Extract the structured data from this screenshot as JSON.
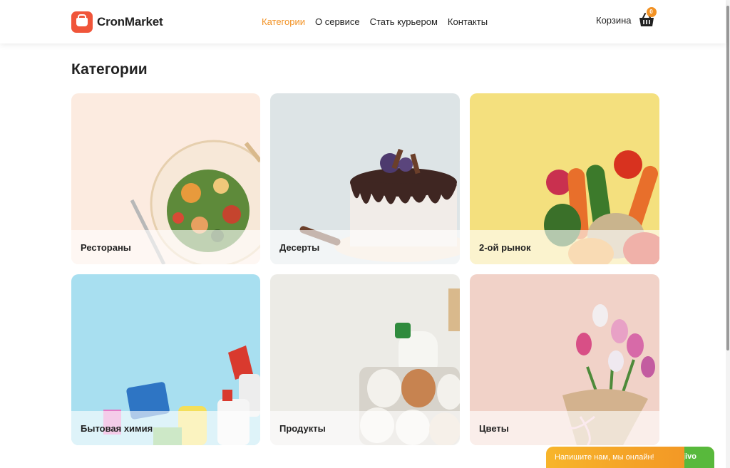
{
  "brand": {
    "name": "CronMarket",
    "accent": "#f29224",
    "logo_color": "#f0553a"
  },
  "nav": {
    "items": [
      {
        "label": "Категории",
        "active": true
      },
      {
        "label": "О сервисе",
        "active": false
      },
      {
        "label": "Стать курьером",
        "active": false
      },
      {
        "label": "Контакты",
        "active": false
      }
    ]
  },
  "cart": {
    "label": "Корзина",
    "count": "0",
    "icon": "basket-icon"
  },
  "page": {
    "title": "Категории"
  },
  "categories": [
    {
      "label": "Рестораны",
      "image": "salad-plate"
    },
    {
      "label": "Десерты",
      "image": "chocolate-cake"
    },
    {
      "label": "2-ой рынок",
      "image": "vegetables"
    },
    {
      "label": "Бытовая химия",
      "image": "cleaning-supplies"
    },
    {
      "label": "Продукты",
      "image": "eggs-and-milk"
    },
    {
      "label": "Цветы",
      "image": "tulip-bouquet"
    }
  ],
  "chat": {
    "text": "Напишите нам, мы онлайн!",
    "logo": "jivo"
  }
}
